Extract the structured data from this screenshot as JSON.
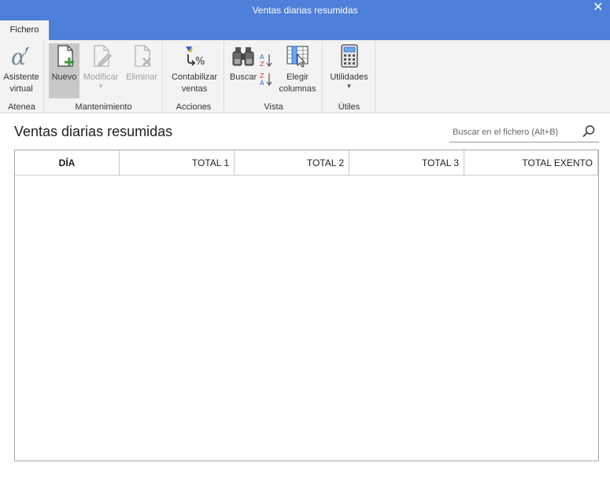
{
  "window": {
    "title": "Ventas diarias resumidas",
    "close_glyph": "✕"
  },
  "tabs": [
    {
      "label": "Fichero",
      "active": true
    }
  ],
  "ribbon": {
    "groups": {
      "atenea": {
        "label": "Atenea",
        "buttons": {
          "asistente": {
            "label": "Asistente virtual",
            "icon": "alpha-icon"
          }
        }
      },
      "mantenimiento": {
        "label": "Mantenimiento",
        "buttons": {
          "nuevo": {
            "label": "Nuevo",
            "icon": "new-document-icon"
          },
          "modificar": {
            "label": "Modificar",
            "icon": "edit-document-icon",
            "disabled": true
          },
          "eliminar": {
            "label": "Eliminar",
            "icon": "delete-document-icon",
            "disabled": true
          }
        }
      },
      "acciones": {
        "label": "Acciones",
        "buttons": {
          "contabilizar": {
            "label": "Contabilizar ventas",
            "icon": "accounting-icon"
          }
        }
      },
      "vista": {
        "label": "Vista",
        "buttons": {
          "buscar": {
            "label": "Buscar",
            "icon": "binoculars-icon"
          },
          "sort_az": {
            "icon": "sort-ascending-icon"
          },
          "sort_za": {
            "icon": "sort-descending-icon"
          },
          "elegir": {
            "label": "Elegir columnas",
            "icon": "choose-columns-icon"
          }
        }
      },
      "utiles": {
        "label": "Útiles",
        "buttons": {
          "utilidades": {
            "label": "Utilidades",
            "icon": "calculator-icon"
          }
        }
      }
    }
  },
  "main": {
    "title": "Ventas diarias resumidas",
    "search": {
      "placeholder": "Buscar en el fichero (Alt+B)",
      "value": ""
    },
    "table": {
      "columns": [
        "DÍA",
        "TOTAL 1",
        "TOTAL 2",
        "TOTAL 3",
        "TOTAL EXENTO"
      ],
      "rows": []
    }
  },
  "colors": {
    "accent": "#4e7fd9",
    "ribbon_bg": "#f3f3f3",
    "new_plus": "#3a9a3a",
    "sort_blue": "#2e6fcf",
    "sort_red": "#d03a3a"
  }
}
